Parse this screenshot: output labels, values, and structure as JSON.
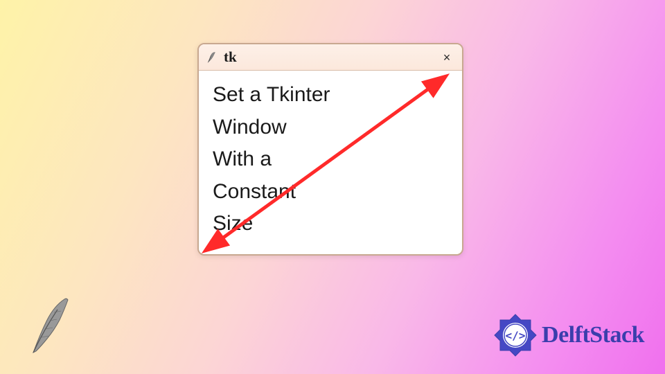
{
  "window": {
    "title": "tk",
    "close_symbol": "×",
    "content_lines": [
      "Set a Tkinter",
      "Window",
      "With a",
      "Constant",
      "Size"
    ]
  },
  "branding": {
    "text": "DelftStack",
    "accent_color": "#3b3eac"
  },
  "arrow": {
    "color": "#ff2a2a"
  }
}
